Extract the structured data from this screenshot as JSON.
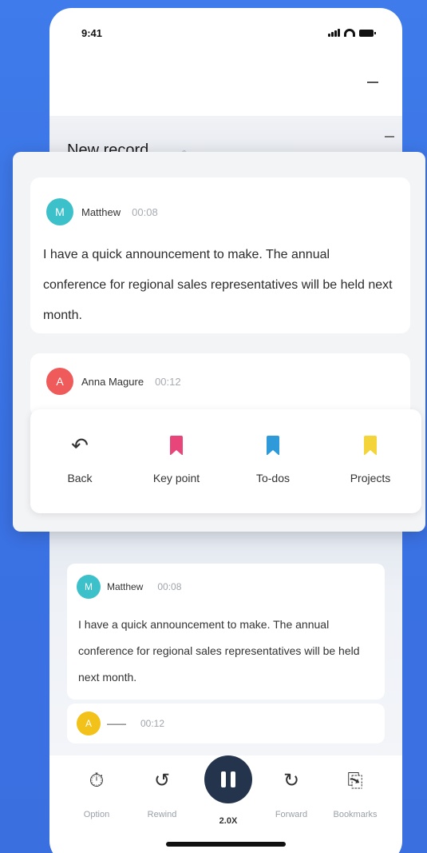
{
  "status": {
    "time": "9:41"
  },
  "record": {
    "title": "New record"
  },
  "overlay": {
    "messages": [
      {
        "initial": "M",
        "name": "Matthew",
        "time": "00:08",
        "text": "I have a quick announcement to make. The annual conference for regional sales representatives will be held next month.",
        "color": "#3cc0c9"
      },
      {
        "initial": "A",
        "name": "Anna Magure",
        "time": "00:12",
        "color": "#ef5a5a"
      }
    ],
    "actions": [
      {
        "label": "Back",
        "icon": "undo-icon"
      },
      {
        "label": "Key point",
        "icon": "bookmark-icon",
        "color": "#e8457a"
      },
      {
        "label": "To-dos",
        "icon": "bookmark-icon",
        "color": "#2e9ad9"
      },
      {
        "label": "Projects",
        "icon": "bookmark-icon",
        "color": "#f3d43a"
      }
    ]
  },
  "background": {
    "messages": [
      {
        "initial": "M",
        "name": "Matthew",
        "time": "00:08",
        "text": "I have a quick announcement to make. The annual conference for regional sales representatives will be held next month.",
        "color": "#3cc0c9"
      },
      {
        "initial": "A",
        "name": "——",
        "time": "00:12",
        "color": "#f2c21b"
      }
    ]
  },
  "player": {
    "controls": [
      {
        "label": "Option",
        "icon": "clock-icon"
      },
      {
        "label": "Rewind",
        "icon": "rewind-icon"
      },
      {
        "label": "2.0X",
        "icon": "pause-icon"
      },
      {
        "label": "Forward",
        "icon": "forward-icon"
      },
      {
        "label": "Bookmarks",
        "icon": "bookmark-list-icon"
      }
    ]
  }
}
